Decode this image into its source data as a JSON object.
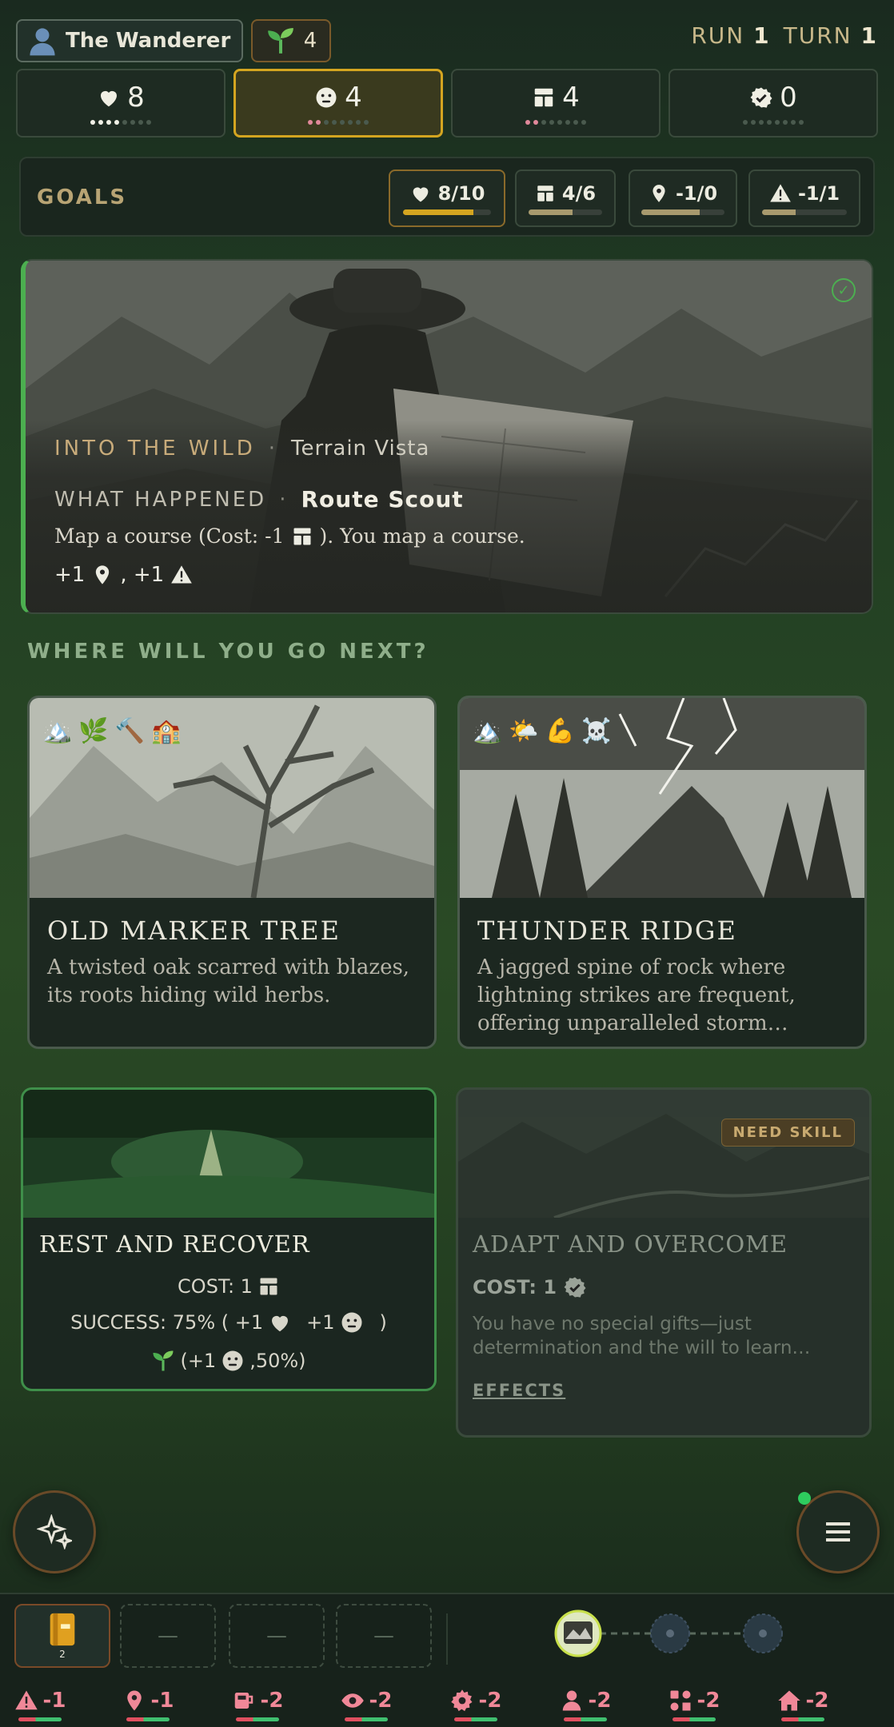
{
  "header": {
    "player_name": "The Wanderer",
    "seeds": "4",
    "run_label": "RUN",
    "run_value": "1",
    "turn_label": "TURN",
    "turn_value": "1"
  },
  "stats": [
    {
      "icon": "heart-icon",
      "value": "8",
      "dots_on": 4,
      "dots_total": 8,
      "dot_color": "white"
    },
    {
      "icon": "neutral-face-icon",
      "value": "4",
      "dots_on": 2,
      "dots_total": 8,
      "dot_color": "pink",
      "active": true
    },
    {
      "icon": "supplies-icon",
      "value": "4",
      "dots_on": 2,
      "dots_total": 8,
      "dot_color": "pink"
    },
    {
      "icon": "badge-check-icon",
      "value": "0",
      "dots_on": 0,
      "dots_total": 8,
      "dot_color": "white"
    }
  ],
  "goals": {
    "label": "GOALS",
    "items": [
      {
        "icon": "heart-icon",
        "value": "8/10",
        "progress": 0.8,
        "highlight": true
      },
      {
        "icon": "supplies-icon",
        "value": "4/6",
        "progress": 0.6
      },
      {
        "icon": "location-pin-icon",
        "value": "-1/0",
        "progress": 0.7
      },
      {
        "icon": "warning-icon",
        "value": "-1/1",
        "progress": 0.4
      }
    ]
  },
  "event": {
    "category": "INTO THE WILD",
    "location": "Terrain Vista",
    "what_happened_label": "WHAT HAPPENED",
    "outcome_name": "Route Scout",
    "description_pre": "Map a course (Cost: -1",
    "description_post": "). You map a course.",
    "reward_a": "+1",
    "reward_sep": ", +1"
  },
  "section_title": "WHERE WILL YOU GO NEXT?",
  "locations": [
    {
      "title": "OLD MARKER TREE",
      "description": "A twisted oak scarred with blazes, its roots hiding wild herbs.",
      "icons": [
        "🏔️",
        "🌿",
        "🔨",
        "🏫"
      ]
    },
    {
      "title": "THUNDER RIDGE",
      "description": "A jagged spine of rock where lightning strikes are frequent, offering unparalleled storm…",
      "icons": [
        "🏔️",
        "🌤️",
        "💪",
        "☠️"
      ]
    }
  ],
  "actions": {
    "rest": {
      "title": "REST AND RECOVER",
      "cost_label": "COST: 1",
      "success_label": "SUCCESS: 75% ( +1",
      "success_mid": "+1",
      "success_end": ")",
      "seed_pre": "(+1",
      "seed_post": ",50%)"
    },
    "adapt": {
      "title": "ADAPT AND OVERCOME",
      "badge": "NEED SKILL",
      "cost_label": "COST: 1",
      "description": "You have no special gifts—just determination and the will to learn…",
      "effects_link": "EFFECTS"
    }
  },
  "inventory": {
    "journal_count": "2",
    "empty_slot": "—"
  },
  "resources": [
    {
      "icon": "warning-icon",
      "value": "-1"
    },
    {
      "icon": "location-pin-icon",
      "value": "-1"
    },
    {
      "icon": "mug-icon",
      "value": "-2"
    },
    {
      "icon": "eye-icon",
      "value": "-2"
    },
    {
      "icon": "gear-icon",
      "value": "-2"
    },
    {
      "icon": "person-icon",
      "value": "-2"
    },
    {
      "icon": "shapes-icon",
      "value": "-2"
    },
    {
      "icon": "home-icon",
      "value": "-2"
    }
  ],
  "colors": {
    "accent_gold": "#d4a520",
    "success_green": "#4caf50",
    "negative_pink": "#f08898"
  }
}
